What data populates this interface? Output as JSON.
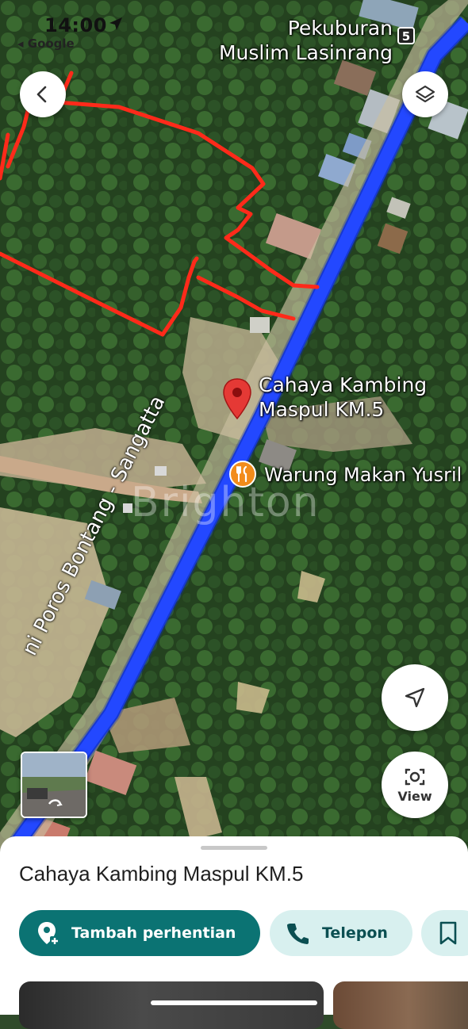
{
  "status_bar": {
    "time": "14:00",
    "source": "◂ Google"
  },
  "map": {
    "labels": {
      "cemetery": "Pekuburan\nMuslim Lasinrang",
      "place": "Cahaya Kambing\nMaspul KM.5",
      "warung": "Warung Makan Yusril",
      "road": "ni Poros Bontang - Sangatta",
      "watermark": "Brighton"
    },
    "route_shield": "5",
    "icons": {
      "back": "back-arrow-icon",
      "layers": "layers-icon",
      "navigate": "navigation-arrow-icon",
      "view": "camera-icon",
      "place_pin": "red-map-pin-icon",
      "restaurant": "fork-knife-icon"
    },
    "view_button_label": "View",
    "colors": {
      "route": "#1b3fe8",
      "annotation": "#ff2a1a",
      "pin": "#e53935",
      "restaurant": "#f28c1b"
    }
  },
  "place_sheet": {
    "title": "Cahaya Kambing Maspul KM.5",
    "actions": [
      {
        "label": "Tambah perhentian",
        "icon": "add-stop-pin-icon"
      },
      {
        "label": "Telepon",
        "icon": "phone-icon"
      },
      {
        "label": "",
        "icon": "bookmark-icon"
      }
    ],
    "accent_color": "#0b7373"
  }
}
